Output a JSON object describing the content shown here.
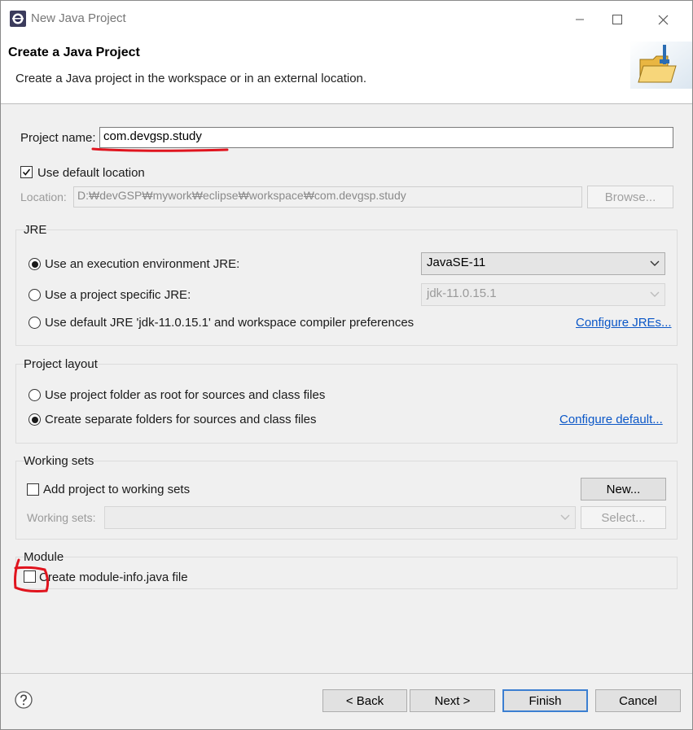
{
  "window": {
    "title": "New Java Project"
  },
  "banner": {
    "title": "Create a Java Project",
    "description": "Create a Java project in the workspace or in an external location."
  },
  "project": {
    "name_label": "Project name:",
    "name_value": "com.devgsp.study"
  },
  "location": {
    "use_default_label": "Use default location",
    "use_default_checked": true,
    "label": "Location:",
    "value": "D:₩devGSP₩mywork₩eclipse₩workspace₩com.devgsp.study",
    "browse_label": "Browse..."
  },
  "jre": {
    "group_label": "JRE",
    "option_env_label": "Use an execution environment JRE:",
    "option_env_value": "JavaSE-11",
    "option_specific_label": "Use a project specific JRE:",
    "option_specific_value": "jdk-11.0.15.1",
    "option_default_label": "Use default JRE 'jdk-11.0.15.1' and workspace compiler preferences",
    "configure_link": "Configure JREs...",
    "selected": "env"
  },
  "layout": {
    "group_label": "Project layout",
    "option_root_label": "Use project folder as root for sources and class files",
    "option_separate_label": "Create separate folders for sources and class files",
    "configure_link": "Configure default...",
    "selected": "separate"
  },
  "working_sets": {
    "group_label": "Working sets",
    "add_label": "Add project to working sets",
    "add_checked": false,
    "new_label": "New...",
    "sets_label": "Working sets:",
    "select_label": "Select..."
  },
  "module": {
    "group_label": "Module",
    "create_label": "Create module-info.java file",
    "create_checked": false
  },
  "footer": {
    "back_label": "< Back",
    "next_label": "Next >",
    "finish_label": "Finish",
    "cancel_label": "Cancel"
  },
  "colors": {
    "annotation": "#e0141e",
    "link": "#0b57c7",
    "default_button_border": "#3c7fd1"
  }
}
